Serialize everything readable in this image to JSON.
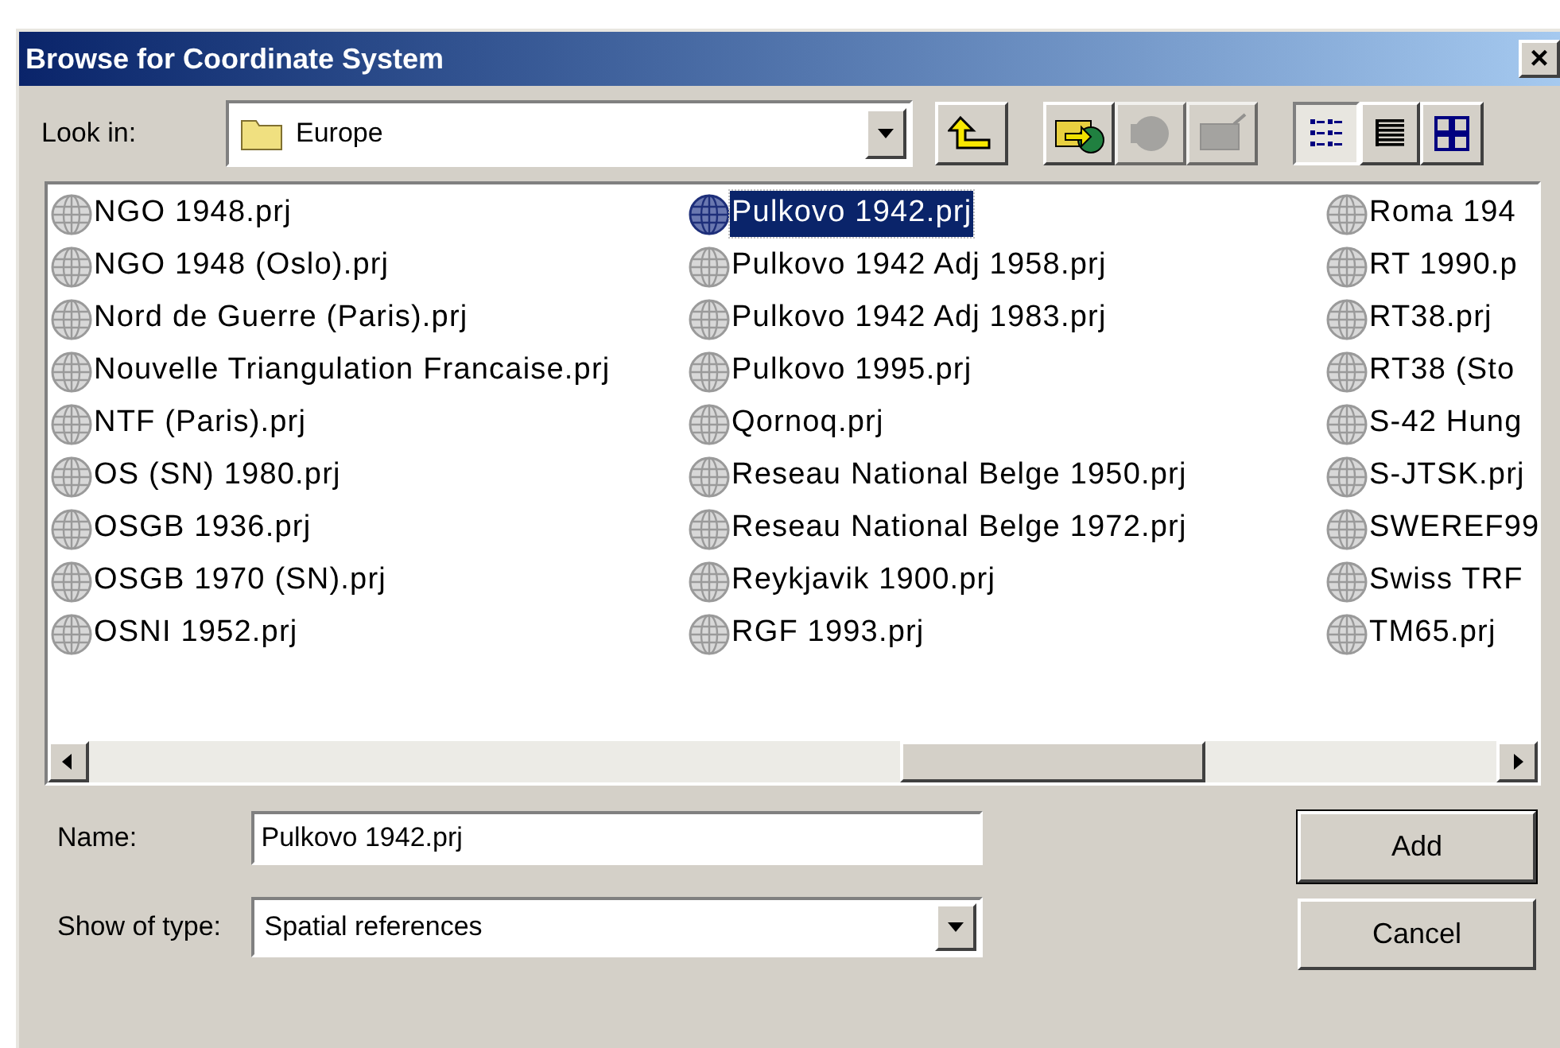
{
  "window": {
    "title": "Browse for Coordinate System",
    "close": "×"
  },
  "look_in": {
    "label": "Look in:",
    "value": "Europe"
  },
  "toolbar": [
    {
      "kind": "up",
      "disabled": false,
      "selected": false
    },
    {
      "kind": "connect",
      "disabled": false,
      "selected": false
    },
    {
      "kind": "disconnect",
      "disabled": true,
      "selected": false
    },
    {
      "kind": "new",
      "disabled": true,
      "selected": false
    },
    {
      "kind": "list",
      "disabled": false,
      "selected": true
    },
    {
      "kind": "details",
      "disabled": false,
      "selected": false
    },
    {
      "kind": "thumbnails",
      "disabled": false,
      "selected": false
    }
  ],
  "files": [
    [
      {
        "name": "NGO 1948.prj",
        "selected": false
      },
      {
        "name": "NGO 1948 (Oslo).prj",
        "selected": false
      },
      {
        "name": "Nord de Guerre (Paris).prj",
        "selected": false
      },
      {
        "name": "Nouvelle Triangulation Francaise.prj",
        "selected": false
      },
      {
        "name": "NTF (Paris).prj",
        "selected": false
      },
      {
        "name": "OS (SN) 1980.prj",
        "selected": false
      },
      {
        "name": "OSGB 1936.prj",
        "selected": false
      },
      {
        "name": "OSGB 1970 (SN).prj",
        "selected": false
      },
      {
        "name": "OSNI 1952.prj",
        "selected": false
      }
    ],
    [
      {
        "name": "Pulkovo 1942.prj",
        "selected": true
      },
      {
        "name": "Pulkovo 1942 Adj 1958.prj",
        "selected": false
      },
      {
        "name": "Pulkovo 1942 Adj 1983.prj",
        "selected": false
      },
      {
        "name": "Pulkovo 1995.prj",
        "selected": false
      },
      {
        "name": "Qornoq.prj",
        "selected": false
      },
      {
        "name": "Reseau National Belge 1950.prj",
        "selected": false
      },
      {
        "name": "Reseau National Belge 1972.prj",
        "selected": false
      },
      {
        "name": "Reykjavik 1900.prj",
        "selected": false
      },
      {
        "name": "RGF 1993.prj",
        "selected": false
      }
    ],
    [
      {
        "name": "Roma 194",
        "selected": false
      },
      {
        "name": "RT 1990.p",
        "selected": false
      },
      {
        "name": "RT38.prj",
        "selected": false
      },
      {
        "name": "RT38 (Sto",
        "selected": false
      },
      {
        "name": "S-42 Hung",
        "selected": false
      },
      {
        "name": "S-JTSK.prj",
        "selected": false
      },
      {
        "name": "SWEREF99",
        "selected": false
      },
      {
        "name": "Swiss TRF",
        "selected": false
      },
      {
        "name": "TM65.prj",
        "selected": false
      }
    ]
  ],
  "name_field": {
    "label": "Name:",
    "value": "Pulkovo 1942.prj"
  },
  "type_field": {
    "label": "Show of type:",
    "value": "Spatial references"
  },
  "buttons": [
    {
      "label": "Add",
      "default": true
    },
    {
      "label": "Cancel",
      "default": false
    }
  ]
}
